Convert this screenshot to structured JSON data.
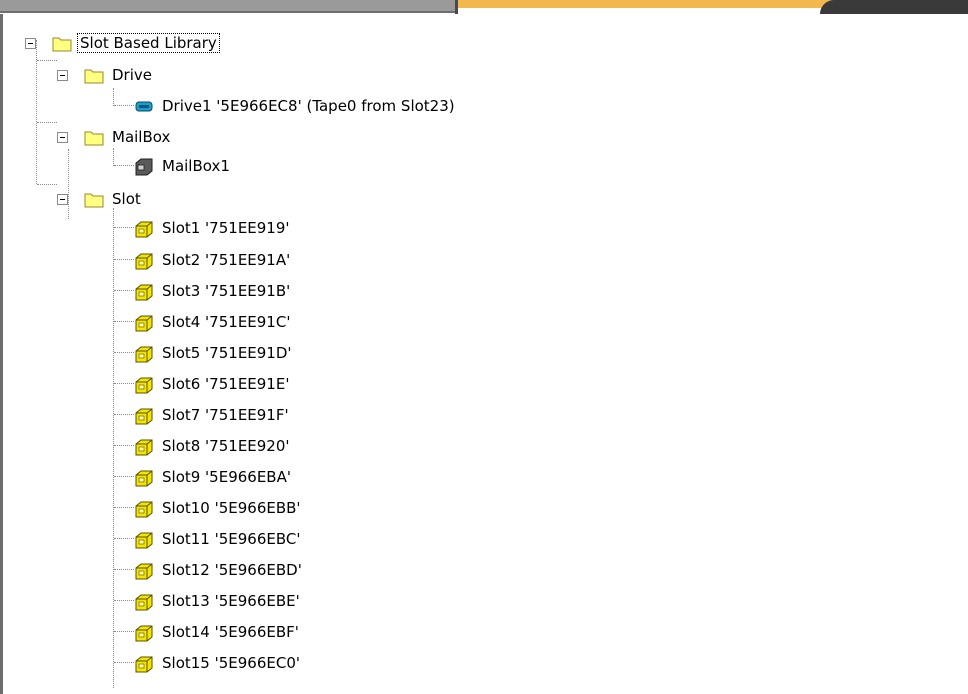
{
  "tree": {
    "root": {
      "label": "Slot Based Library",
      "icon": "folder-icon",
      "expanded": true,
      "selected": true
    },
    "drive_group": {
      "label": "Drive",
      "icon": "folder-icon",
      "expanded": true
    },
    "drive1": {
      "label": "Drive1 '5E966EC8' (Tape0 from Slot23)",
      "icon": "tape-drive-icon"
    },
    "mailbox_group": {
      "label": "MailBox",
      "icon": "folder-icon",
      "expanded": true
    },
    "mailbox1": {
      "label": "MailBox1",
      "icon": "mailbox-icon"
    },
    "slot_group": {
      "label": "Slot",
      "icon": "folder-icon",
      "expanded": true
    },
    "slots": [
      "Slot1 '751EE919'",
      "Slot2 '751EE91A'",
      "Slot3 '751EE91B'",
      "Slot4 '751EE91C'",
      "Slot5 '751EE91D'",
      "Slot6 '751EE91E'",
      "Slot7 '751EE91F'",
      "Slot8 '751EE920'",
      "Slot9 '5E966EBA'",
      "Slot10 '5E966EBB'",
      "Slot11 '5E966EBC'",
      "Slot12 '5E966EBD'",
      "Slot13 '5E966EBE'",
      "Slot14 '5E966EBF'",
      "Slot15 '5E966EC0'"
    ]
  },
  "icons": {
    "slot_item": "tape-cartridge-icon"
  },
  "colors": {
    "folder": "#ffff80",
    "tape_cartridge": "#f2e600",
    "drive": "#1aa0c8",
    "accent_bar": "#f2b84d"
  }
}
